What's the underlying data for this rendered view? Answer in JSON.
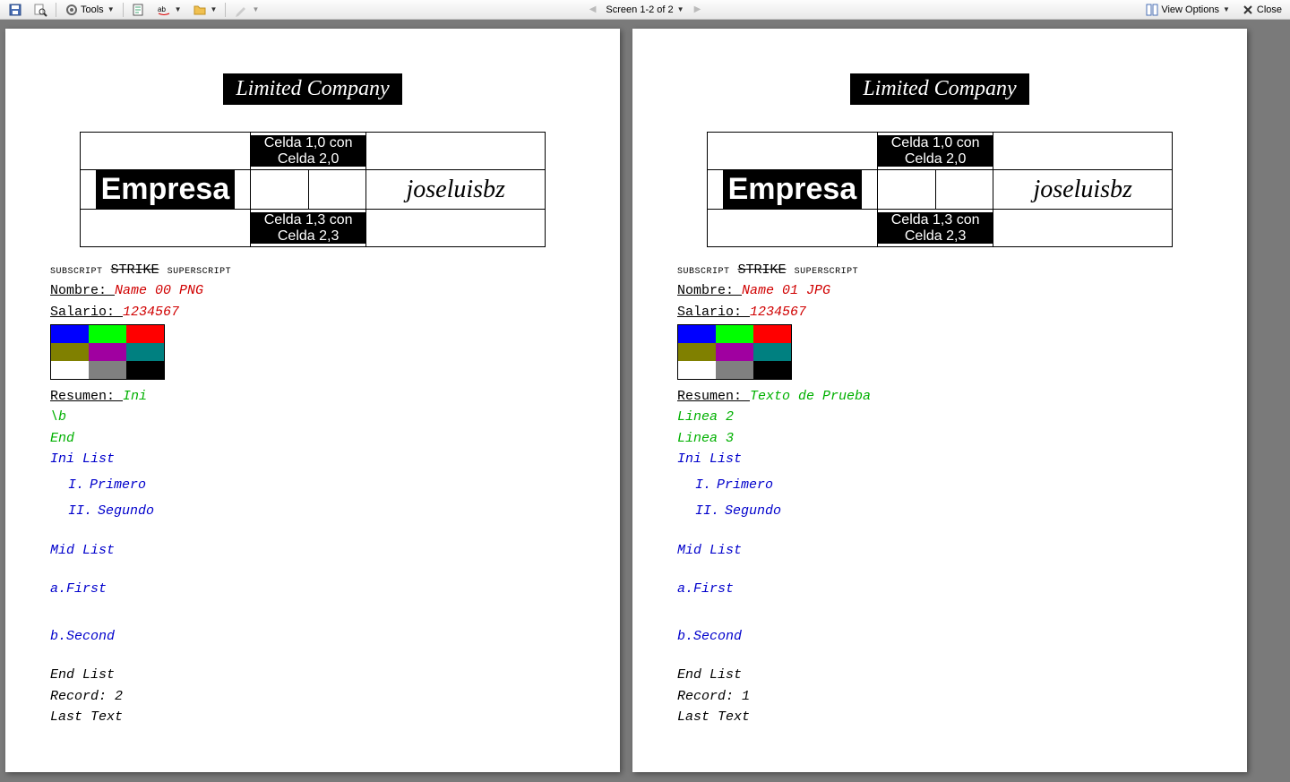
{
  "toolbar": {
    "tools_label": "Tools",
    "center_nav": "Screen 1-2 of 2",
    "view_options_label": "View Options",
    "close_label": "Close"
  },
  "document": {
    "header_text": "Limited Company",
    "empresa_label": "Empresa",
    "signature_text": "joseluisbz",
    "cell_1_0": "Celda 1,0 con Celda 2,0",
    "cell_1_3": "Celda 1,3 con Celda 2,3",
    "subscript_label": "SUBSCRIPT",
    "strike_label": "STRIKE",
    "superscript_label": "SUPERSCRIPT",
    "nombre_label": "Nombre: ",
    "salario_label": "Salario: ",
    "resumen_label": "Resumen: ",
    "salario_value": "1234567",
    "ini_list_label": "Ini List",
    "mid_list_label": "Mid List",
    "end_list_label": "End List",
    "last_text_label": "Last Text",
    "roman_1": "I.",
    "roman_2": "II.",
    "letter_a": "a.",
    "letter_b": "b.",
    "primero": "Primero",
    "segundo": "Segundo",
    "first": "First",
    "second": "Second",
    "backslash_b": "\\b",
    "end_label": "End",
    "color_grid": [
      [
        "#0000ff",
        "#00ff00",
        "#ff0000"
      ],
      [
        "#808000",
        "#a000a0",
        "#008080"
      ],
      [
        "#ffffff",
        "#808080",
        "#000000"
      ]
    ]
  },
  "pages": [
    {
      "nombre_value": "Name 00 PNG",
      "resumen_value": "Ini",
      "extra_lines": [
        "\\b",
        "End"
      ],
      "record_label": "Record: 2"
    },
    {
      "nombre_value": "Name 01 JPG",
      "resumen_value": "Texto de Prueba",
      "extra_lines": [
        "Linea 2",
        "Linea 3"
      ],
      "record_label": "Record: 1"
    }
  ]
}
